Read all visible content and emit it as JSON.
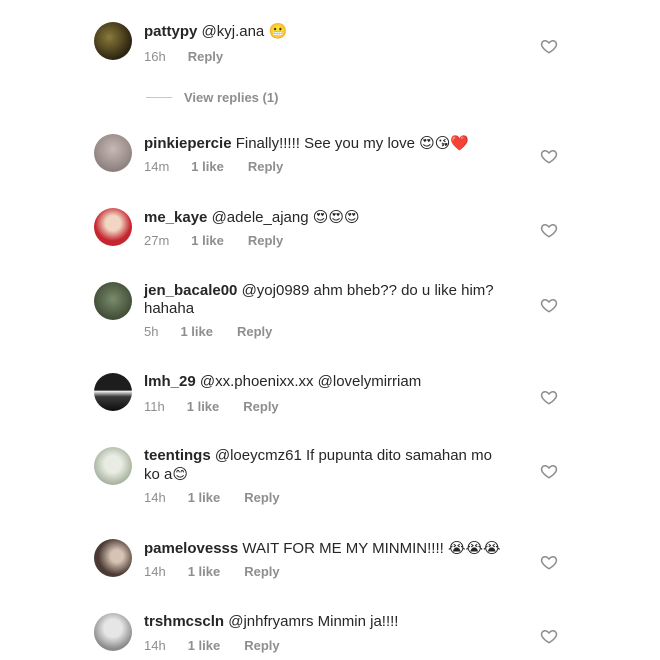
{
  "comments": [
    {
      "username": "pattypy",
      "text": "@kyj.ana",
      "emoji": "😬",
      "age": "16h",
      "likes": "",
      "reply": "Reply"
    },
    {
      "username": "pinkiepercie",
      "text": "Finally!!!!! See you my love",
      "emoji": "😍😘❤️",
      "age": "14m",
      "likes": "1 like",
      "reply": "Reply"
    },
    {
      "username": "me_kaye",
      "text": "@adele_ajang",
      "emoji": "😍😍😍",
      "age": "27m",
      "likes": "1 like",
      "reply": "Reply"
    },
    {
      "username": "jen_bacale00",
      "text": "@yoj0989 ahm bheb?? do u like him?",
      "text2": "hahaha",
      "age": "5h",
      "likes": "1 like",
      "reply": "Reply"
    },
    {
      "username": "lmh_29",
      "text": "@xx.phoenixx.xx @lovelymirriam",
      "age": "11h",
      "likes": "1 like",
      "reply": "Reply"
    },
    {
      "username": "teentings",
      "text": "@loeycmz61 If pupunta dito samahan mo",
      "text2": "ko a",
      "emoji": "😊",
      "age": "14h",
      "likes": "1 like",
      "reply": "Reply"
    },
    {
      "username": "pamelovesss",
      "text": "WAIT FOR ME MY MINMIN!!!!",
      "emoji": "😭😭😭",
      "age": "14h",
      "likes": "1 like",
      "reply": "Reply"
    },
    {
      "username": "trshmcscln",
      "text": "@jnhfryamrs Minmin ja!!!!",
      "age": "14h",
      "likes": "1 like",
      "reply": "Reply"
    }
  ],
  "view_replies": "View replies (1)"
}
